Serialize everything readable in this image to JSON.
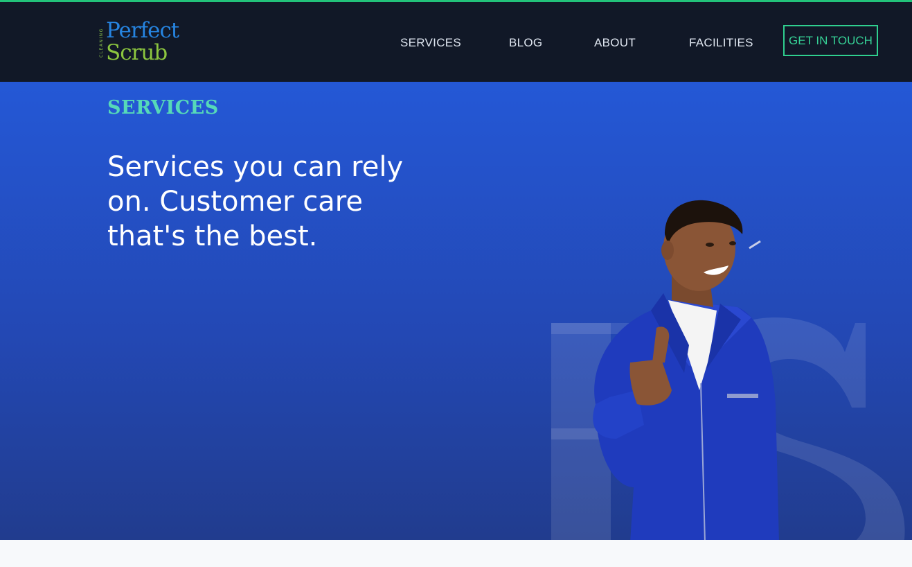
{
  "brand": {
    "tagline": "CLEANING",
    "word1": "Perfect",
    "word2": "Scrub",
    "accent_color": "#22c27a",
    "blue": "#2684e0",
    "green": "#8cc63f"
  },
  "nav": {
    "items": [
      {
        "label": "SERVICES"
      },
      {
        "label": "BLOG"
      },
      {
        "label": "ABOUT"
      },
      {
        "label": "FACILITIES"
      }
    ],
    "cta_label": "GET IN TOUCH"
  },
  "hero": {
    "eyebrow": "SERVICES",
    "headline": "Services you can rely on. Customer care that's the best.",
    "background_color": "#2458d6",
    "eyebrow_color": "#56d9b8",
    "image": "smiling-cleaner-thumbs-up"
  }
}
